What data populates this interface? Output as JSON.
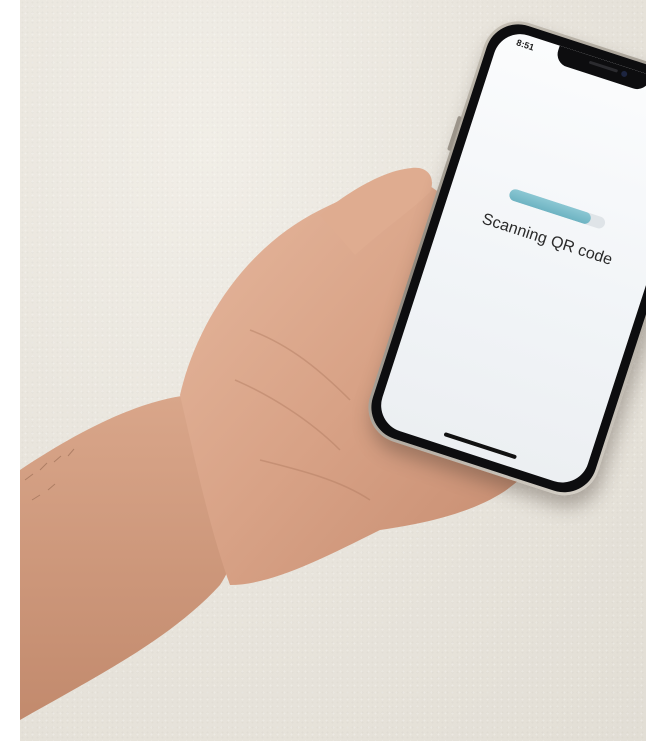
{
  "phone": {
    "status_bar": {
      "time": "8:51",
      "icons": [
        "signal-icon",
        "wifi-icon",
        "battery-icon"
      ]
    },
    "screen": {
      "progress_fraction": 0.85,
      "status_text": "Scanning QR code"
    }
  },
  "colors": {
    "wall": "#e8e4dc",
    "skin": "#d9a58a",
    "screen_background": "#f4f6f8",
    "progress_fill": "#7dbcc9",
    "progress_track": "#dfe4e8",
    "phone_frame": "#0d0d0f"
  }
}
